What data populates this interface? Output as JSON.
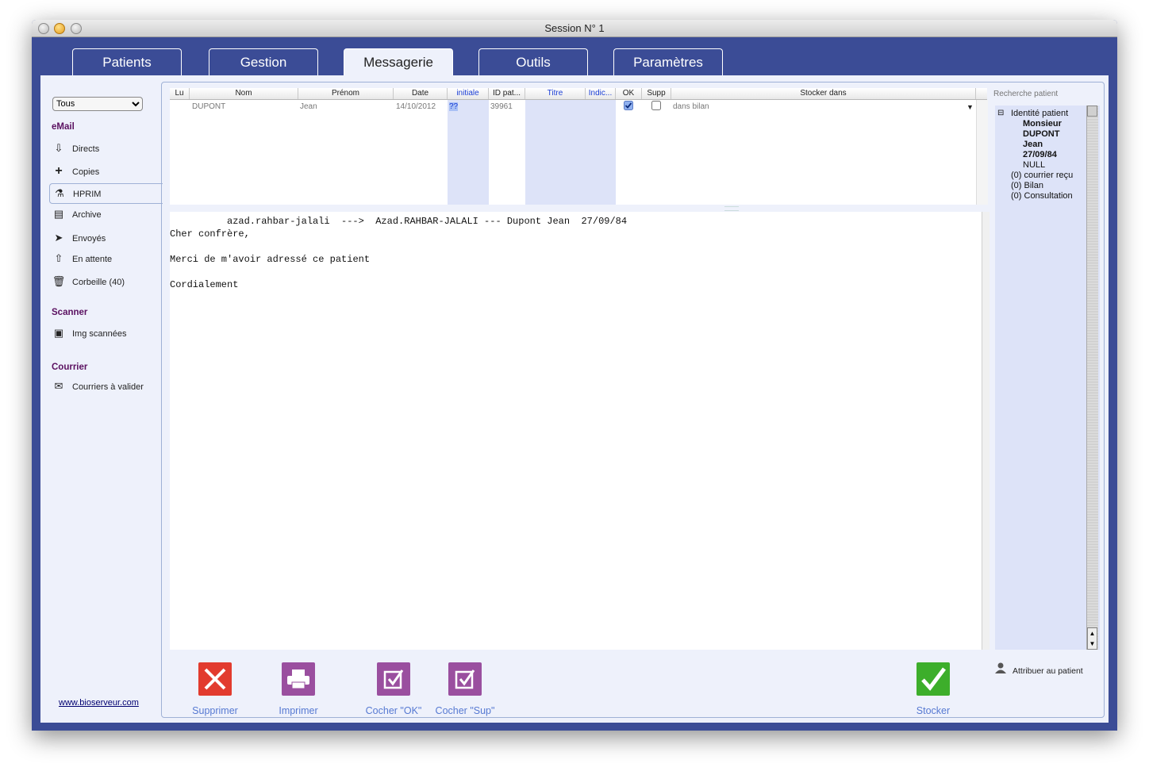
{
  "window": {
    "title": "Session N° 1"
  },
  "tabs": [
    "Patients",
    "Gestion",
    "Messagerie",
    "Outils",
    "Paramètres"
  ],
  "sidebar": {
    "filter": "Tous",
    "email_header": "eMail",
    "email_items": [
      "Directs",
      "Copies",
      "HPRIM",
      "Archive",
      "Envoyés",
      "En attente",
      "Corbeille (40)"
    ],
    "scanner_header": "Scanner",
    "scanner_items": [
      "Img scannées"
    ],
    "courrier_header": "Courrier",
    "courrier_items": [
      "Courriers à valider"
    ],
    "website": "www.bioserveur.com"
  },
  "grid": {
    "headers": [
      "Lu",
      "Nom",
      "Prénom",
      "Date",
      "initiale",
      "ID pat...",
      "Titre",
      "Indic...",
      "OK",
      "Supp",
      "Stocker dans"
    ],
    "rows": [
      {
        "nom": "DUPONT",
        "prenom": "Jean",
        "date": "14/10/2012",
        "initiale": "??",
        "id": "39961",
        "ok": true,
        "supp": false,
        "stocker": "dans bilan"
      }
    ]
  },
  "message": {
    "line1": "azad.rahbar-jalali  --->  Azad.RAHBAR-JALALI --- Dupont Jean  27/09/84",
    "line2": "Cher confrère,",
    "line3": "Merci de m'avoir adressé ce patient",
    "line4": "Cordialement"
  },
  "actions": {
    "delete": "Supprimer",
    "print": "Imprimer",
    "check_ok": "Cocher \"OK\"",
    "check_sup": "Cocher \"Sup\"",
    "store": "Stocker"
  },
  "patient_panel": {
    "search_placeholder": "Recherche patient",
    "tree_root": "Identité patient",
    "civility": "Monsieur",
    "lastname": "DUPONT",
    "firstname": "Jean",
    "birthdate": "27/09/84",
    "extra": "NULL",
    "courrier": "(0) courrier reçu",
    "bilan": "(0) Bilan",
    "consultation": "(0) Consultation",
    "assign": "Attribuer au patient"
  },
  "colors": {
    "frame": "#3b4c96",
    "panel": "#eef1fb",
    "delete": "#e23b2e",
    "purple": "#9a4f9f",
    "store": "#3dae2b"
  }
}
